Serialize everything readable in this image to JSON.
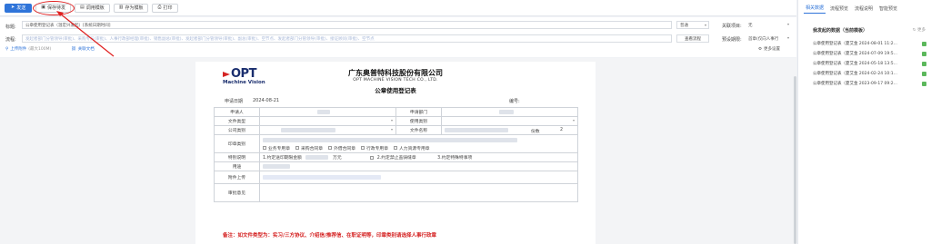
{
  "toolbar": {
    "submit_label": "发送",
    "save_label": "保存待发",
    "template_label": "调用模板",
    "save_template_label": "存为模板",
    "print_label": "打印"
  },
  "header": {
    "title_label": "标题:",
    "title_value": "公章使用登记表（温宏兴发起）[系统日期时间]",
    "importance_value": "普通",
    "related_label": "关联项目:",
    "related_value": "无",
    "flow_label": "流程:",
    "flow_value": "发起者部门分管领导(审批)、采购专员(审批)、人事行政部经理(审批)、销售副总(审批)、发起者部门分管领导(审批)、副总(审批)、空节点、发起者部门分管领导(审批)、接证顾问(审批)、空节点",
    "edit_flow_label": "查看流程",
    "deadline_label": "预设期限:",
    "deadline_value": "首章(仅向人事行",
    "upload_label": "上传附件",
    "upload_hint": "(最大100M)",
    "related_doc_label": "关联文档",
    "more_settings_label": "更多设置"
  },
  "doc": {
    "logo_text": "OPT",
    "logo_sub": "Machine Vision",
    "company_cn": "广东奥普特科技股份有限公司",
    "company_en": "OPT MACHINE VISION TECH CO., LTD.",
    "form_title": "公章使用登记表",
    "date_label": "申请日期",
    "date_value": "2024-08-21",
    "serial_label": "编号:",
    "rows": {
      "applicant": "申请人",
      "dept": "申请部门",
      "file_type": "文件类型",
      "use_type": "使用类别",
      "company": "公司类别",
      "file_name": "文件名称",
      "copies": "份数",
      "copies_value": "2",
      "seal_type": "印章类别",
      "special": "特别说明",
      "purpose": "用途",
      "attachment": "附件上传",
      "opinion": "审批意见"
    },
    "checkboxes": [
      "业务专用章",
      "采购合同章",
      "外借合同章",
      "行政专用章",
      "人力资源专用章"
    ],
    "special_notes": [
      "1.约定送印期限金额",
      "万元",
      "2.约定禁止盖骑缝章",
      "3.约定特殊特事项"
    ],
    "note": "备注：如文件类型为：实习/三方协议、介绍信/推荐信、在职证明等，印章类别请选择人事行政章"
  },
  "right_panel": {
    "tabs": [
      "相关数据",
      "流程预览",
      "流程说明",
      "智能预览"
    ],
    "title": "我发起的数据（当前模板）",
    "more": "更多",
    "items": [
      {
        "text": "公章使用登记表（夏艾金 2024-08-01 11:2...",
        "badge": "green"
      },
      {
        "text": "公章使用登记表（夏艾金 2024-07-09 19:5...",
        "badge": "green"
      },
      {
        "text": "公章使用登记表（夏艾金 2024-05-18 13:5...",
        "badge": "green"
      },
      {
        "text": "公章使用登记表（夏艾金 2024-02-24 10:1...",
        "badge": "green"
      },
      {
        "text": "公章使用登记表（夏艾金 2023-09-17 09:2...",
        "badge": "green"
      }
    ]
  },
  "colors": {
    "primary": "#2f74d9",
    "annotation": "#e02020",
    "note": "#d41f1f",
    "badge": "#5cb85c"
  }
}
